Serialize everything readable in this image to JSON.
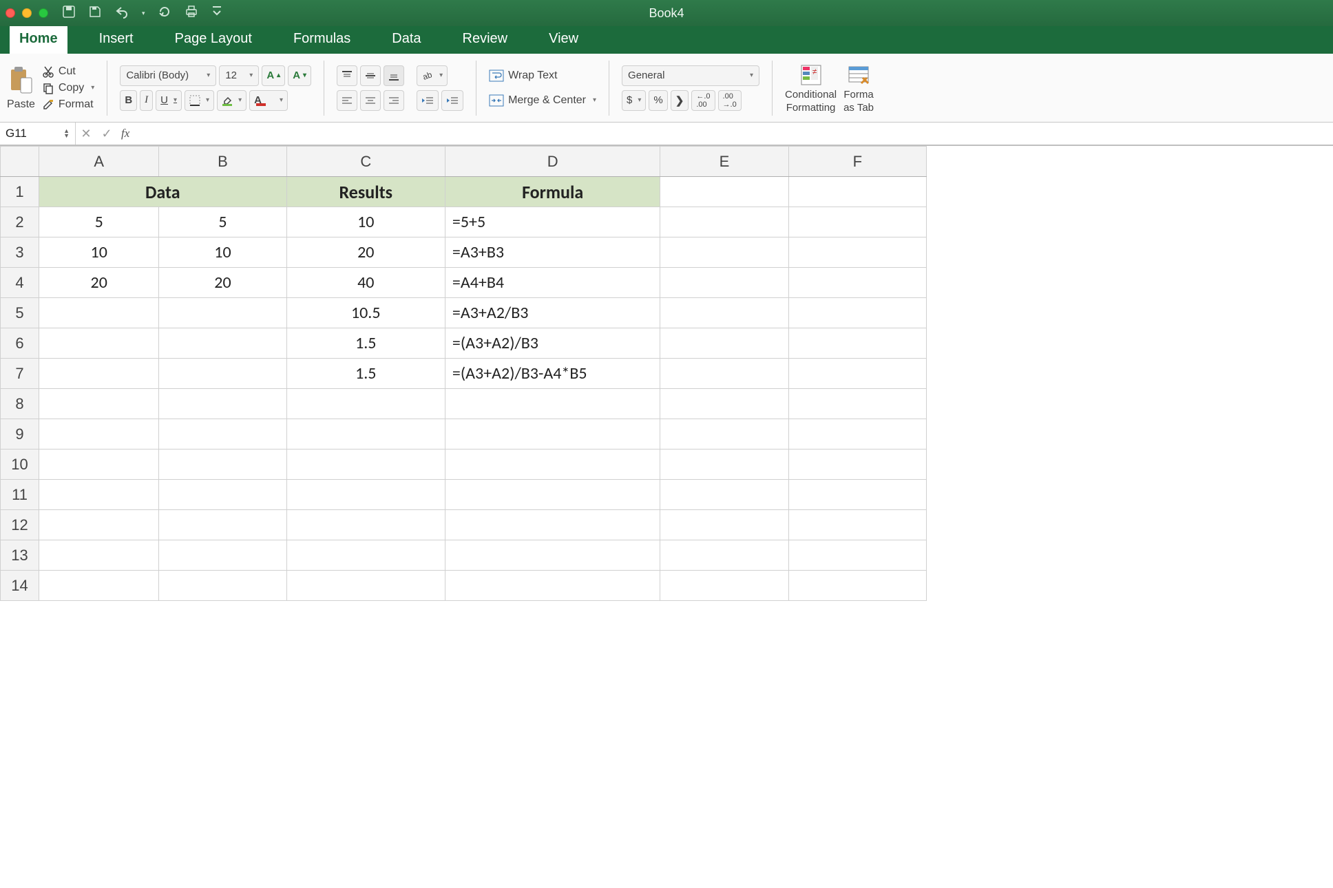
{
  "title": "Book4",
  "tabs": [
    "Home",
    "Insert",
    "Page Layout",
    "Formulas",
    "Data",
    "Review",
    "View"
  ],
  "active_tab": "Home",
  "clipboard": {
    "paste": "Paste",
    "cut": "Cut",
    "copy": "Copy",
    "format": "Format"
  },
  "font": {
    "name": "Calibri (Body)",
    "size": "12",
    "bold": "B",
    "italic": "I",
    "underline": "U"
  },
  "alignment": {
    "wrap": "Wrap Text",
    "merge": "Merge & Center"
  },
  "number": {
    "format": "General",
    "currency": "$",
    "percent": "%",
    "comma": "❯"
  },
  "styles": {
    "cond": "Conditional",
    "cond2": "Formatting",
    "table": "Forma",
    "table2": "as Tab"
  },
  "name_box": "G11",
  "formula_input": "",
  "columns": [
    "A",
    "B",
    "C",
    "D",
    "E",
    "F"
  ],
  "row_numbers": [
    "1",
    "2",
    "3",
    "4",
    "5",
    "6",
    "7",
    "8",
    "9",
    "10",
    "11",
    "12",
    "13",
    "14"
  ],
  "headers": {
    "data": "Data",
    "results": "Results",
    "formula": "Formula"
  },
  "cells": {
    "A2": "5",
    "B2": "5",
    "C2": "10",
    "D2": "=5+5",
    "A3": "10",
    "B3": "10",
    "C3": "20",
    "D3": "=A3+B3",
    "A4": "20",
    "B4": "20",
    "C4": "40",
    "D4": "=A4+B4",
    "C5": "10.5",
    "D5": "=A3+A2/B3",
    "C6": "1.5",
    "D6": "=(A3+A2)/B3",
    "C7": "1.5",
    "D7": "=(A3+A2)/B3-A4*B5"
  },
  "selected_cell": "G11"
}
